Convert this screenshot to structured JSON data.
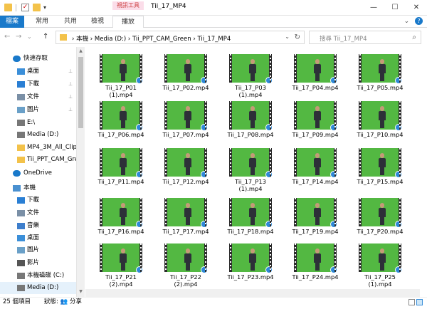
{
  "window": {
    "title": "Tii_17_MP4",
    "context_tab_group": "視訊工具",
    "min_icon": "—",
    "max_icon": "☐",
    "close_icon": "✕"
  },
  "ribbon": {
    "tabs": [
      "檔案",
      "常用",
      "共用",
      "檢視",
      "播放"
    ],
    "expand_icon": "⌄",
    "help_icon": "?"
  },
  "address": {
    "path": "› 本機  ›  Media (D:)  ›  Tii_PPT_CAM_Green  ›  Tii_17_MP4",
    "search_placeholder": "搜尋 Tii_17_MP4",
    "back_icon": "←",
    "forward_icon": "→",
    "up_icon": "↑",
    "recent_icon": "⌄",
    "dropdown_icon": "⌄",
    "refresh_icon": "↻",
    "search_icon": "⌕"
  },
  "sidebar": {
    "items": [
      {
        "label": "快速存取",
        "icon": "star-icon",
        "color": "#1979ca",
        "pinned": false
      },
      {
        "label": "桌面",
        "icon": "desktop-icon",
        "color": "#3b8fd9",
        "pinned": true
      },
      {
        "label": "下載",
        "icon": "download-icon",
        "color": "#2a7fd4",
        "pinned": true
      },
      {
        "label": "文件",
        "icon": "document-icon",
        "color": "#7a8fa6",
        "pinned": true
      },
      {
        "label": "圖片",
        "icon": "pictures-icon",
        "color": "#6aa0c8",
        "pinned": true
      },
      {
        "label": "E:\\",
        "icon": "drive-icon",
        "color": "#777777",
        "pinned": false
      },
      {
        "label": "Media (D:)",
        "icon": "drive-icon",
        "color": "#777777",
        "pinned": false
      },
      {
        "label": "MP4_3M_All_Clip",
        "icon": "folder-icon",
        "color": "#f3c24a",
        "pinned": false
      },
      {
        "label": "Tii_PPT_CAM_Gree",
        "icon": "folder-icon",
        "color": "#f3c24a",
        "pinned": false
      },
      {
        "label": "OneDrive",
        "icon": "cloud-icon",
        "color": "#1979ca",
        "pinned": false
      },
      {
        "label": "本機",
        "icon": "computer-icon",
        "color": "#4a90d0",
        "pinned": false
      },
      {
        "label": "下載",
        "icon": "download-icon",
        "color": "#2a7fd4",
        "pinned": false
      },
      {
        "label": "文件",
        "icon": "document-icon",
        "color": "#7a8fa6",
        "pinned": false
      },
      {
        "label": "音樂",
        "icon": "music-icon",
        "color": "#3d7ecc",
        "pinned": false
      },
      {
        "label": "桌面",
        "icon": "desktop-icon",
        "color": "#3b8fd9",
        "pinned": false
      },
      {
        "label": "圖片",
        "icon": "pictures-icon",
        "color": "#6aa0c8",
        "pinned": false
      },
      {
        "label": "影片",
        "icon": "video-icon",
        "color": "#555555",
        "pinned": false
      },
      {
        "label": "本機磁碟 (C:)",
        "icon": "drive-icon",
        "color": "#777777",
        "pinned": false
      },
      {
        "label": "Media (D:)",
        "icon": "drive-icon",
        "color": "#777777",
        "pinned": false
      }
    ],
    "pin_icon": "📌"
  },
  "files": [
    "Tii_17_P01\n(1).mp4",
    "Tii_17_P02.mp4",
    "Tii_17_P03\n(1).mp4",
    "Tii_17_P04.mp4",
    "Tii_17_P05.mp4",
    "Tii_17_P06.mp4",
    "Tii_17_P07.mp4",
    "Tii_17_P08.mp4",
    "Tii_17_P09.mp4",
    "Tii_17_P10.mp4",
    "Tii_17_P11.mp4",
    "Tii_17_P12.mp4",
    "Tii_17_P13\n(1).mp4",
    "Tii_17_P14.mp4",
    "Tii_17_P15.mp4",
    "Tii_17_P16.mp4",
    "Tii_17_P17.mp4",
    "Tii_17_P18.mp4",
    "Tii_17_P19.mp4",
    "Tii_17_P20.mp4",
    "Tii_17_P21\n(2).mp4",
    "Tii_17_P22\n(2).mp4",
    "Tii_17_P23.mp4",
    "Tii_17_P24.mp4",
    "Tii_17_P25\n(1).mp4"
  ],
  "status": {
    "count": "25 個項目",
    "state": "狀態: 👥 分享"
  },
  "colors": {
    "accent": "#1979ca",
    "green_screen": "#53b842",
    "badge": "#2e88d8"
  }
}
